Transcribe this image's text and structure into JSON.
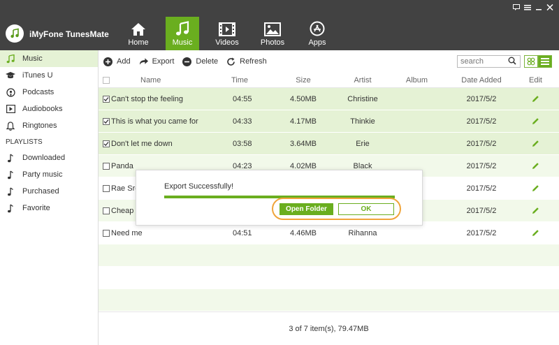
{
  "app": {
    "title": "iMyFone TunesMate"
  },
  "nav": [
    {
      "label": "Home",
      "icon": "home-icon"
    },
    {
      "label": "Music",
      "icon": "music-icon",
      "active": true
    },
    {
      "label": "Videos",
      "icon": "film-icon"
    },
    {
      "label": "Photos",
      "icon": "photo-icon"
    },
    {
      "label": "Apps",
      "icon": "appstore-icon"
    }
  ],
  "sidebar": {
    "items": [
      {
        "label": "Music",
        "icon": "music-note-icon",
        "active": true
      },
      {
        "label": "iTunes U",
        "icon": "graduation-cap-icon"
      },
      {
        "label": "Podcasts",
        "icon": "podcast-icon"
      },
      {
        "label": "Audiobooks",
        "icon": "audiobook-icon"
      },
      {
        "label": "Ringtones",
        "icon": "bell-icon"
      }
    ],
    "playlists_heading": "PLAYLISTS",
    "playlists": [
      {
        "label": "Downloaded",
        "icon": "music-note-icon"
      },
      {
        "label": "Party music",
        "icon": "music-note-icon"
      },
      {
        "label": "Purchased",
        "icon": "music-note-icon"
      },
      {
        "label": "Favorite",
        "icon": "music-note-icon"
      }
    ]
  },
  "toolbar": {
    "add": "Add",
    "export": "Export",
    "delete": "Delete",
    "refresh": "Refresh",
    "search_placeholder": "search"
  },
  "table": {
    "headers": {
      "name": "Name",
      "time": "Time",
      "size": "Size",
      "artist": "Artist",
      "album": "Album",
      "date_added": "Date Added",
      "edit": "Edit"
    },
    "rows": [
      {
        "checked": true,
        "name": "Can't stop the feeling",
        "time": "04:55",
        "size": "4.50MB",
        "artist": "Christine",
        "album": "",
        "date": "2017/5/2"
      },
      {
        "checked": true,
        "name": "This is what you came for",
        "time": "04:33",
        "size": "4.17MB",
        "artist": "Thinkie",
        "album": "",
        "date": "2017/5/2"
      },
      {
        "checked": true,
        "name": "Don't let me down",
        "time": "03:58",
        "size": "3.64MB",
        "artist": "Erie",
        "album": "",
        "date": "2017/5/2"
      },
      {
        "checked": false,
        "name": "Panda",
        "time": "04:23",
        "size": "4.02MB",
        "artist": "Black",
        "album": "",
        "date": "2017/5/2"
      },
      {
        "checked": false,
        "name": "Rae Sre",
        "time": "",
        "size": "",
        "artist": "",
        "album": "",
        "date": "2017/5/2"
      },
      {
        "checked": false,
        "name": "Cheap T",
        "time": "",
        "size": "",
        "artist": "",
        "album": "",
        "date": "2017/5/2"
      },
      {
        "checked": false,
        "name": "Need me",
        "time": "04:51",
        "size": "4.46MB",
        "artist": "Rihanna",
        "album": "",
        "date": "2017/5/2"
      }
    ]
  },
  "footer": {
    "status": "3 of 7 item(s), 79.47MB"
  },
  "dialog": {
    "message": "Export Successfully!",
    "progress": 1.0,
    "open_folder": "Open Folder",
    "ok": "OK"
  },
  "colors": {
    "accent": "#6aae1f",
    "titlebar": "#424242",
    "highlight": "#f0a43a",
    "row_tint": "#f2f9ea"
  }
}
